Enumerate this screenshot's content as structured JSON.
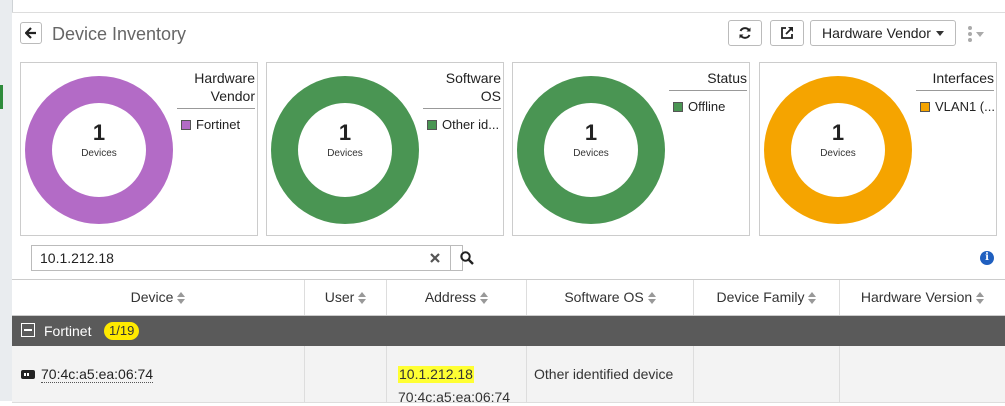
{
  "header": {
    "title": "Device Inventory",
    "group_by_label": "Hardware Vendor"
  },
  "icons": {
    "back": "arrow-left-icon",
    "refresh": "refresh-icon",
    "open": "external-link-icon",
    "more": "kebab-menu-icon"
  },
  "cards": [
    {
      "title_line1": "Hardware",
      "title_line2": "Vendor",
      "count": "1",
      "count_label": "Devices",
      "legend": "Fortinet",
      "color": "#b36bc6"
    },
    {
      "title_line1": "Software",
      "title_line2": "OS",
      "count": "1",
      "count_label": "Devices",
      "legend": "Other id...",
      "color": "#4a9553"
    },
    {
      "title_line1": "Status",
      "title_line2": "",
      "count": "1",
      "count_label": "Devices",
      "legend": "Offline",
      "color": "#4a9553"
    },
    {
      "title_line1": "Interfaces",
      "title_line2": "",
      "count": "1",
      "count_label": "Devices",
      "legend": "VLAN1 (...",
      "color": "#f5a400"
    }
  ],
  "search": {
    "value": "10.1.212.18"
  },
  "table": {
    "columns": [
      "Device",
      "User",
      "Address",
      "Software OS",
      "Device Family",
      "Hardware Version"
    ],
    "group": {
      "name": "Fortinet",
      "count": "1/19"
    },
    "rows": [
      {
        "device": "70:4c:a5:ea:06:74",
        "user": "",
        "address_ip": "10.1.212.18",
        "address_mac": "70:4c:a5:ea:06:74",
        "software_os": "Other identified device",
        "device_family": "",
        "hardware_version": ""
      }
    ]
  }
}
